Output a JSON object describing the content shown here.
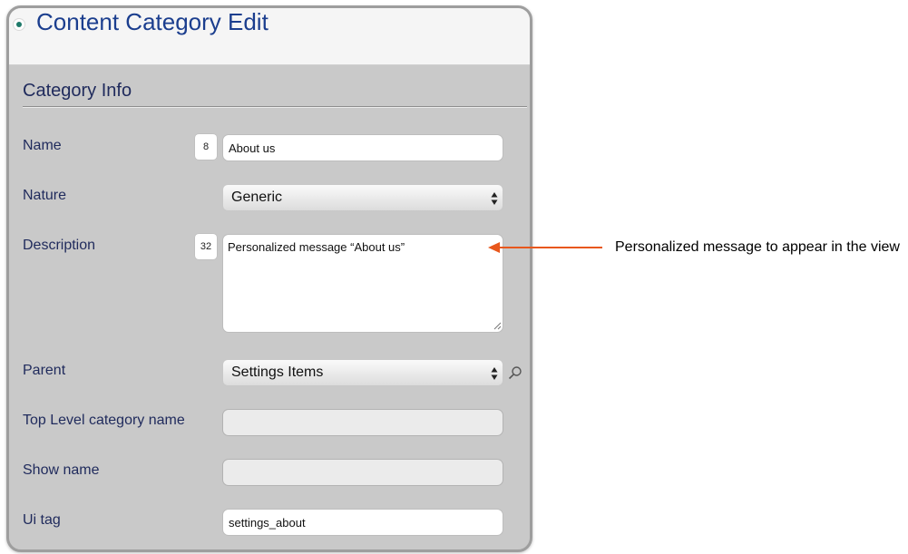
{
  "header": {
    "title": "Content Category Edit"
  },
  "section": {
    "title": "Category Info"
  },
  "fields": {
    "name": {
      "label": "Name",
      "count": "8",
      "value": "About us"
    },
    "nature": {
      "label": "Nature",
      "selected": "Generic"
    },
    "description": {
      "label": "Description",
      "count": "32",
      "value": "Personalized message “About us”"
    },
    "parent": {
      "label": "Parent",
      "selected": "Settings Items"
    },
    "top_level": {
      "label": "Top Level category name",
      "value": ""
    },
    "show_name": {
      "label": "Show name",
      "value": ""
    },
    "ui_tag": {
      "label": "Ui tag",
      "value": "settings_about"
    }
  },
  "annotation": {
    "text": "Personalized message to appear in the view",
    "color": "#e8571c"
  },
  "icons": {
    "bullet": "radio-bullet-icon",
    "lookup": "magnifier-icon",
    "select_arrows": "updown-arrows-icon"
  },
  "colors": {
    "title": "#1b3e8e",
    "label": "#1f2a5c",
    "panel": "#c9c9c9",
    "bullet": "#1f7a6a"
  }
}
